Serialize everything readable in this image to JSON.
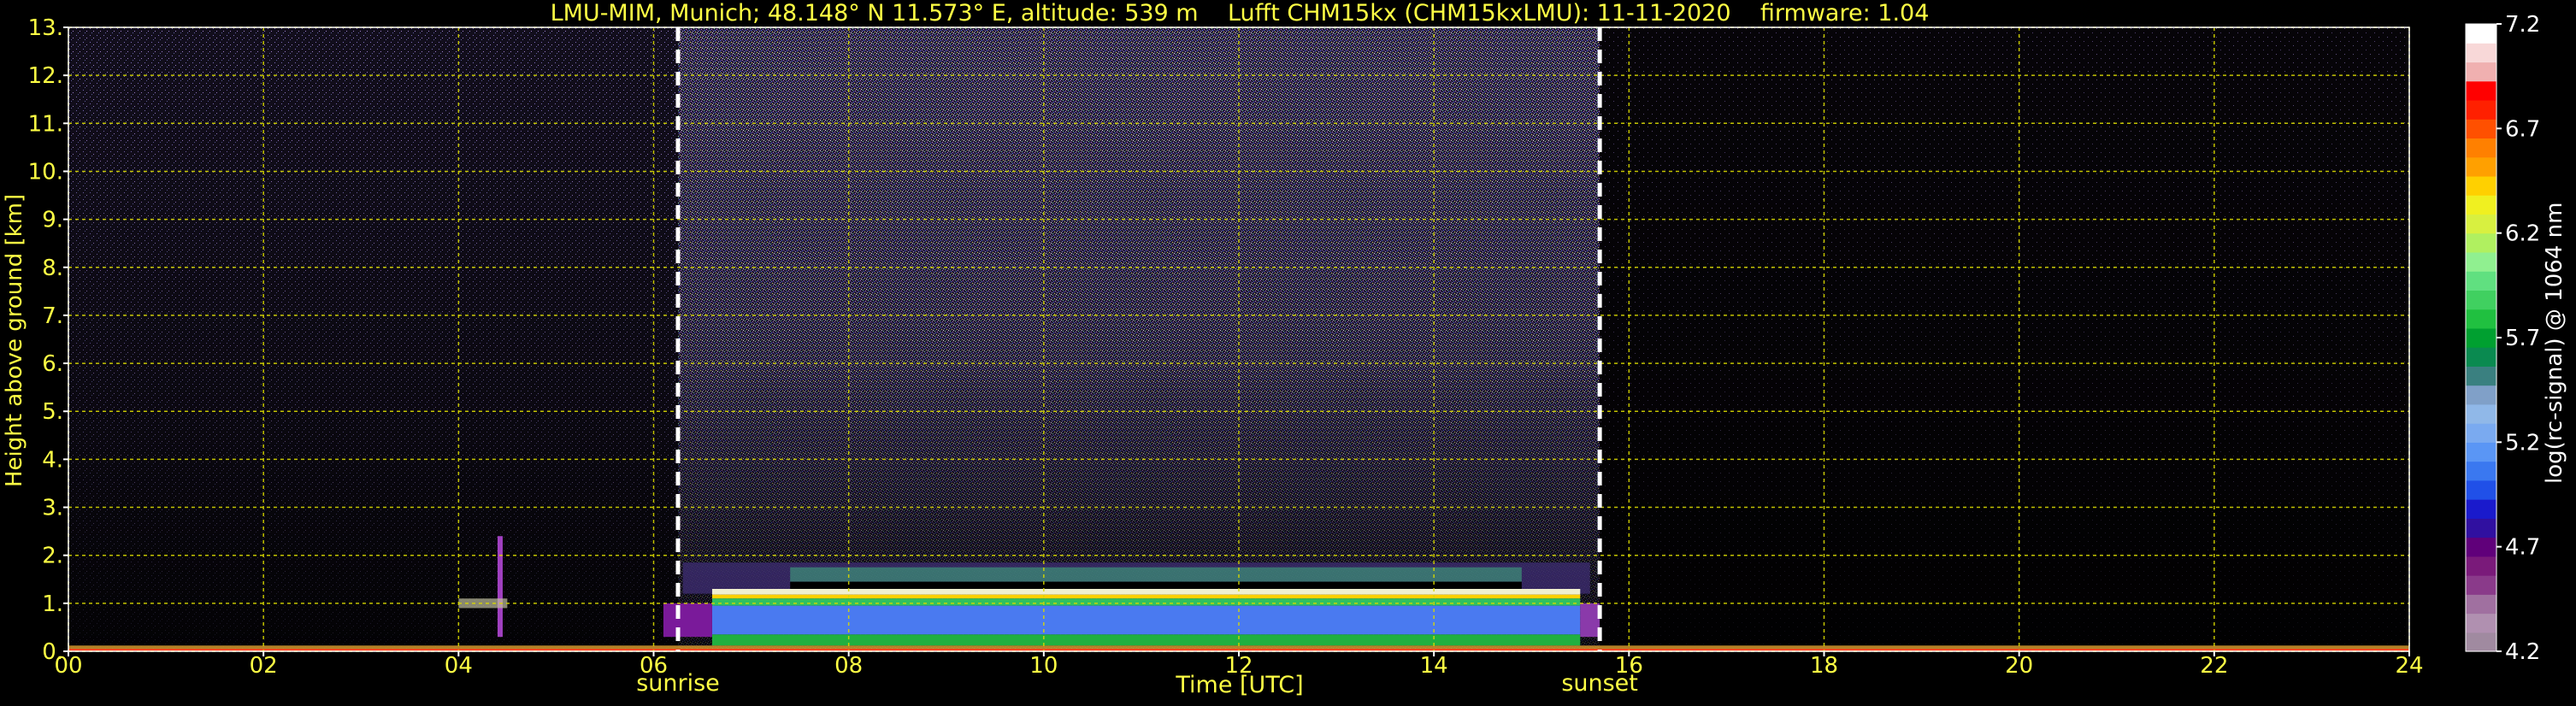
{
  "chart_data": {
    "type": "heatmap",
    "title": "LMU-MIM, Munich; 48.148° N 11.573° E, altitude: 539 m    Lufft CHM15kx (CHM15kxLMU): 11-11-2020    firmware: 1.04",
    "xlabel": "Time [UTC]",
    "ylabel": "Height above ground [km]",
    "x_ticks": [
      "00",
      "02",
      "04",
      "06",
      "08",
      "10",
      "12",
      "14",
      "16",
      "18",
      "20",
      "22",
      "24"
    ],
    "y_ticks": [
      "0.",
      "1.",
      "2.",
      "3.",
      "4.",
      "5.",
      "6.",
      "7.",
      "8.",
      "9.",
      "10.",
      "11.",
      "12.",
      "13."
    ],
    "xlim": [
      0,
      24
    ],
    "ylim": [
      0,
      13
    ],
    "grid": true,
    "colorbar": {
      "label": "log(rc-signal) @ 1064 nm",
      "range": [
        4.2,
        7.2
      ],
      "ticks": [
        "7.2",
        "6.7",
        "6.2",
        "5.7",
        "5.2",
        "4.7",
        "4.2"
      ],
      "colors": [
        "#a08aa0",
        "#b090b0",
        "#a070a0",
        "#8a3a8a",
        "#7a1a7a",
        "#60007a",
        "#3010a0",
        "#1a1acc",
        "#2050e8",
        "#3a78f0",
        "#5a96f5",
        "#7aaaf0",
        "#90b8e8",
        "#80a0c8",
        "#3a8080",
        "#0a8a50",
        "#00a030",
        "#20c040",
        "#40d060",
        "#60e080",
        "#90f090",
        "#b0f060",
        "#d8f040",
        "#f0f020",
        "#ffd000",
        "#ffa000",
        "#ff8000",
        "#ff5000",
        "#ff2000",
        "#ff0000",
        "#f0b0b0",
        "#f8d8d8",
        "#ffffff"
      ]
    },
    "events": [
      {
        "label": "sunrise",
        "x": 6.25
      },
      {
        "label": "sunset",
        "x": 15.7
      }
    ],
    "aerosol_layer": {
      "start": 6.3,
      "end": 15.6,
      "top_km": 1.3
    }
  }
}
